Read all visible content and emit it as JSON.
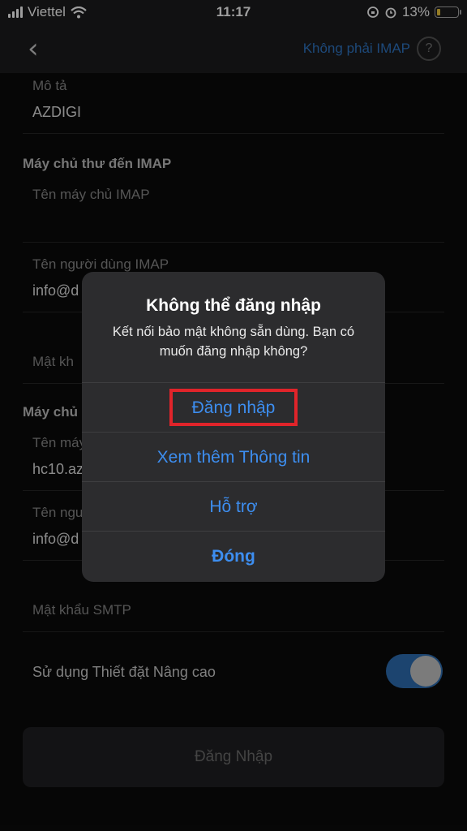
{
  "status": {
    "carrier": "Viettel",
    "time": "11:17",
    "battery": "13%"
  },
  "nav": {
    "back_icon": "chevron-left-icon",
    "not_imap_label": "Không phải IMAP",
    "help_label": "?"
  },
  "form": {
    "description_label": "Mô tả",
    "description_value": "AZDIGI",
    "incoming_section": "Máy chủ thư đến IMAP",
    "imap_host_label": "Tên máy chủ IMAP",
    "imap_user_label": "Tên người dùng IMAP",
    "imap_user_value": "info@d",
    "imap_password_label": "Mật kh",
    "outgoing_section": "Máy chủ",
    "smtp_host_label": "Tên máy",
    "smtp_host_value": "hc10.az",
    "smtp_user_label": "Tên ngư",
    "smtp_user_value": "info@d",
    "smtp_password_label": "Mật khẩu SMTP",
    "advanced_label": "Sử dụng Thiết đặt Nâng cao",
    "advanced_enabled": true,
    "login_button": "Đăng Nhập"
  },
  "alert": {
    "title": "Không thể đăng nhập",
    "message": "Kết nối bảo mật không sẵn dùng. Bạn có muốn đăng nhập không?",
    "buttons": [
      "Đăng nhập",
      "Xem thêm Thông tin",
      "Hỗ trợ",
      "Đóng"
    ]
  },
  "colors": {
    "accent": "#3d8ef0",
    "highlight_box": "#e0242a"
  }
}
